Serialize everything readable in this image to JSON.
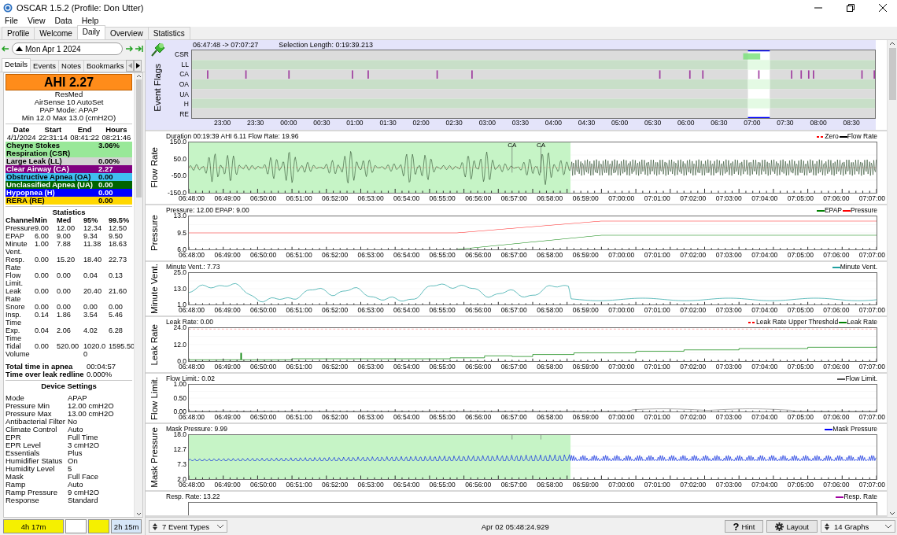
{
  "window": {
    "title": "OSCAR 1.5.2 (Profile: Don Utter)"
  },
  "menu": [
    "File",
    "View",
    "Data",
    "Help"
  ],
  "tabs": [
    {
      "label": "Profile",
      "selected": false
    },
    {
      "label": "Welcome",
      "selected": false
    },
    {
      "label": "Daily",
      "selected": true
    },
    {
      "label": "Overview",
      "selected": false
    },
    {
      "label": "Statistics",
      "selected": false
    }
  ],
  "date_nav": {
    "date": "Mon Apr 1 2024"
  },
  "detail_tabs": [
    {
      "label": "Details",
      "selected": true
    },
    {
      "label": "Events",
      "selected": false
    },
    {
      "label": "Notes",
      "selected": false
    },
    {
      "label": "Bookmarks",
      "selected": false
    }
  ],
  "summary": {
    "ahi": "AHI 2.27",
    "lines": [
      "ResMed",
      "AirSense 10 AutoSet",
      "PAP Mode: APAP",
      "Min 12.0 Max 13.0 (cmH2O)"
    ]
  },
  "session": {
    "columns": [
      "Date",
      "Start",
      "End",
      "Hours"
    ],
    "values": [
      "4/1/2024",
      "22:31:14",
      "08:41:22",
      "08:21:46"
    ]
  },
  "events": [
    {
      "label": "Cheyne Stokes Respiration (CSR)",
      "value": "3.06%",
      "color": "#98e898"
    },
    {
      "label": "Large Leak (LL)",
      "value": "0.00%",
      "color": "#d3d3d3"
    },
    {
      "label": "Clear Airway (CA)",
      "value": "2.27",
      "color": "#800080"
    },
    {
      "label": "Obstructive Apnea (OA)",
      "value": "0.00",
      "color": "#40bff0"
    },
    {
      "label": "Unclassified Apnea (UA)",
      "value": "0.00",
      "color": "#006400"
    },
    {
      "label": "Hypopnea (H)",
      "value": "0.00",
      "color": "#0000ff"
    },
    {
      "label": "RERA (RE)",
      "value": "0.00",
      "color": "#ffd700"
    }
  ],
  "statistics": {
    "title": "Statistics",
    "columns": [
      "Channel",
      "Min",
      "Med",
      "95%",
      "99.5%"
    ],
    "rows": [
      [
        "Pressure",
        "9.00",
        "12.00",
        "12.34",
        "12.50"
      ],
      [
        "EPAP",
        "6.00",
        "9.00",
        "9.34",
        "9.50"
      ],
      [
        "Minute Vent.",
        "1.00",
        "7.88",
        "11.38",
        "18.63"
      ],
      [
        "Resp. Rate",
        "0.00",
        "15.20",
        "18.40",
        "22.73"
      ],
      [
        "Flow Limit.",
        "0.00",
        "0.00",
        "0.04",
        "0.13"
      ],
      [
        "Leak Rate",
        "0.00",
        "0.00",
        "20.40",
        "21.60"
      ],
      [
        "Snore",
        "0.00",
        "0.00",
        "0.00",
        "0.00"
      ],
      [
        "Insp. Time",
        "0.14",
        "1.86",
        "3.54",
        "5.46"
      ],
      [
        "Exp. Time",
        "0.04",
        "2.06",
        "4.02",
        "6.28"
      ],
      [
        "Tidal Volume",
        "0.00",
        "520.00",
        "1020.00",
        "1595.50"
      ]
    ]
  },
  "totals": [
    {
      "label": "Total time in apnea",
      "value": "00:04:57"
    },
    {
      "label": "Time over leak redline",
      "value": "0.000%"
    }
  ],
  "device_settings": {
    "title": "Device Settings",
    "rows": [
      [
        "Mode",
        "APAP"
      ],
      [
        "Pressure Min",
        "12.00 cmH2O"
      ],
      [
        "Pressure Max",
        "13.00 cmH2O"
      ],
      [
        "Antibacterial Filter",
        "No"
      ],
      [
        "Climate Control",
        "Auto"
      ],
      [
        "EPR",
        "Full Time"
      ],
      [
        "EPR Level",
        "3 cmH2O"
      ],
      [
        "Essentials",
        "Plus"
      ],
      [
        "Humidifier Status",
        "On"
      ],
      [
        "Humidity Level",
        "5"
      ],
      [
        "Mask",
        "Full Face"
      ],
      [
        "Ramp",
        "Auto"
      ],
      [
        "Ramp Pressure",
        "9 cmH2O"
      ],
      [
        "Response",
        "Standard"
      ]
    ]
  },
  "timeline": [
    {
      "label": "4h 17m",
      "color": "#f5f000"
    },
    {
      "color": "#ffffff"
    },
    {
      "color": "#f5f000"
    },
    {
      "label": "2h 15m",
      "color": "#d6e6f8"
    }
  ],
  "event_flags": {
    "title": "Event Flags",
    "range": "06:47:48 -> 07:07:27",
    "selection": "Selection Length: 0:19:39.213",
    "rows": [
      "CSR",
      "LL",
      "CA",
      "OA",
      "UA",
      "H",
      "RE"
    ],
    "x_labels": [
      "23:00",
      "23:30",
      "00:00",
      "00:30",
      "01:00",
      "01:30",
      "02:00",
      "02:30",
      "03:00",
      "03:30",
      "04:00",
      "04:30",
      "05:00",
      "05:30",
      "06:00",
      "06:30",
      "07:00",
      "07:30",
      "08:00",
      "08:30"
    ]
  },
  "graphs": [
    {
      "kind": "flow",
      "title": "Flow Rate",
      "header": "Duration 00:19:39 AHI 6.11 Flow Rate: 19.96",
      "legend": [
        {
          "label": "Zero",
          "color": "#ff0000",
          "dashed": true
        },
        {
          "label": "Flow Rate",
          "color": "#000000",
          "dashed": false
        }
      ],
      "markers": [
        "CA",
        "CA"
      ],
      "y_labels": [
        "150.0",
        "50.0",
        "-50.0",
        "-150.0"
      ],
      "x_labels": [
        "06:48:00",
        "06:49:00",
        "06:50:00",
        "06:51:00",
        "06:52:00",
        "06:53:00",
        "06:54:00",
        "06:55:00",
        "06:56:00",
        "06:57:00",
        "06:58:00",
        "06:59:00",
        "07:00:00",
        "07:01:00",
        "07:02:00",
        "07:03:00",
        "07:04:00",
        "07:05:00",
        "07:06:00",
        "07:07:00"
      ]
    },
    {
      "kind": "pressure",
      "title": "Pressure",
      "header": "Pressure: 12.00 EPAP: 9.00",
      "legend": [
        {
          "label": "EPAP",
          "color": "#008000",
          "dashed": false
        },
        {
          "label": "Pressure",
          "color": "#ff0000",
          "dashed": false
        }
      ],
      "y_labels": [
        "13.0",
        "9.5",
        "6.0"
      ],
      "x_labels": [
        "06:48:00",
        "06:49:00",
        "06:50:00",
        "06:51:00",
        "06:52:00",
        "06:53:00",
        "06:54:00",
        "06:55:00",
        "06:56:00",
        "06:57:00",
        "06:58:00",
        "06:59:00",
        "07:00:00",
        "07:01:00",
        "07:02:00",
        "07:03:00",
        "07:04:00",
        "07:05:00",
        "07:06:00",
        "07:07:00"
      ]
    },
    {
      "kind": "minute",
      "title": "Minute Vent.",
      "header": "Minute Vent.: 7.73",
      "legend": [
        {
          "label": "Minute Vent.",
          "color": "#20a0a0",
          "dashed": false
        }
      ],
      "y_labels": [
        "25.0",
        "13.0",
        "1.0"
      ],
      "x_labels": [
        "06:48:00",
        "06:49:00",
        "06:50:00",
        "06:51:00",
        "06:52:00",
        "06:53:00",
        "06:54:00",
        "06:55:00",
        "06:56:00",
        "06:57:00",
        "06:58:00",
        "06:59:00",
        "07:00:00",
        "07:01:00",
        "07:02:00",
        "07:03:00",
        "07:04:00",
        "07:05:00",
        "07:06:00",
        "07:07:00"
      ]
    },
    {
      "kind": "leak",
      "title": "Leak Rate",
      "header": "Leak Rate: 0.00",
      "legend": [
        {
          "label": "Leak Rate Upper Threshold",
          "color": "#ff0000",
          "dashed": true
        },
        {
          "label": "Leak Rate",
          "color": "#008000",
          "dashed": false
        }
      ],
      "y_labels": [
        "24.0",
        "12.0",
        "0.0"
      ],
      "x_labels": [
        "06:48:00",
        "06:49:00",
        "06:50:00",
        "06:51:00",
        "06:52:00",
        "06:53:00",
        "06:54:00",
        "06:55:00",
        "06:56:00",
        "06:57:00",
        "06:58:00",
        "06:59:00",
        "07:00:00",
        "07:01:00",
        "07:02:00",
        "07:03:00",
        "07:04:00",
        "07:05:00",
        "07:06:00",
        "07:07:00"
      ]
    },
    {
      "kind": "flowlimit",
      "title": "Flow Limit.",
      "header": "Flow Limit.: 0.02",
      "legend": [
        {
          "label": "Flow Limit.",
          "color": "#555555",
          "dashed": false
        }
      ],
      "y_labels": [
        "1.00",
        "0.50",
        "0.00"
      ],
      "x_labels": [
        "06:48:00",
        "06:49:00",
        "06:50:00",
        "06:51:00",
        "06:52:00",
        "06:53:00",
        "06:54:00",
        "06:55:00",
        "06:56:00",
        "06:57:00",
        "06:58:00",
        "06:59:00",
        "07:00:00",
        "07:01:00",
        "07:02:00",
        "07:03:00",
        "07:04:00",
        "07:05:00",
        "07:06:00",
        "07:07:00"
      ]
    },
    {
      "kind": "mask",
      "title": "Mask Pressure",
      "header": "Mask Pressure: 9.99",
      "legend": [
        {
          "label": "Mask Pressure",
          "color": "#0000ff",
          "dashed": false
        }
      ],
      "y_labels": [
        "18.0",
        "12.7",
        "7.3",
        "2.0"
      ],
      "x_labels": [
        "06:48:00",
        "06:49:00",
        "06:50:00",
        "06:51:00",
        "06:52:00",
        "06:53:00",
        "06:54:00",
        "06:55:00",
        "06:56:00",
        "06:57:00",
        "06:58:00",
        "06:59:00",
        "07:00:00",
        "07:01:00",
        "07:02:00",
        "07:03:00",
        "07:04:00",
        "07:05:00",
        "07:06:00",
        "07:07:00"
      ]
    },
    {
      "kind": "resp",
      "header": "Resp. Rate: 13.22",
      "legend": [
        {
          "label": "Resp. Rate",
          "color": "#a000a0",
          "dashed": false
        }
      ]
    }
  ],
  "status_bar": {
    "event_types": "7 Event Types",
    "time": "Apr 02 05:48:24.929",
    "hint_icon": "?",
    "hint": "Hint",
    "layout": "Layout",
    "graphs": "14 Graphs"
  }
}
